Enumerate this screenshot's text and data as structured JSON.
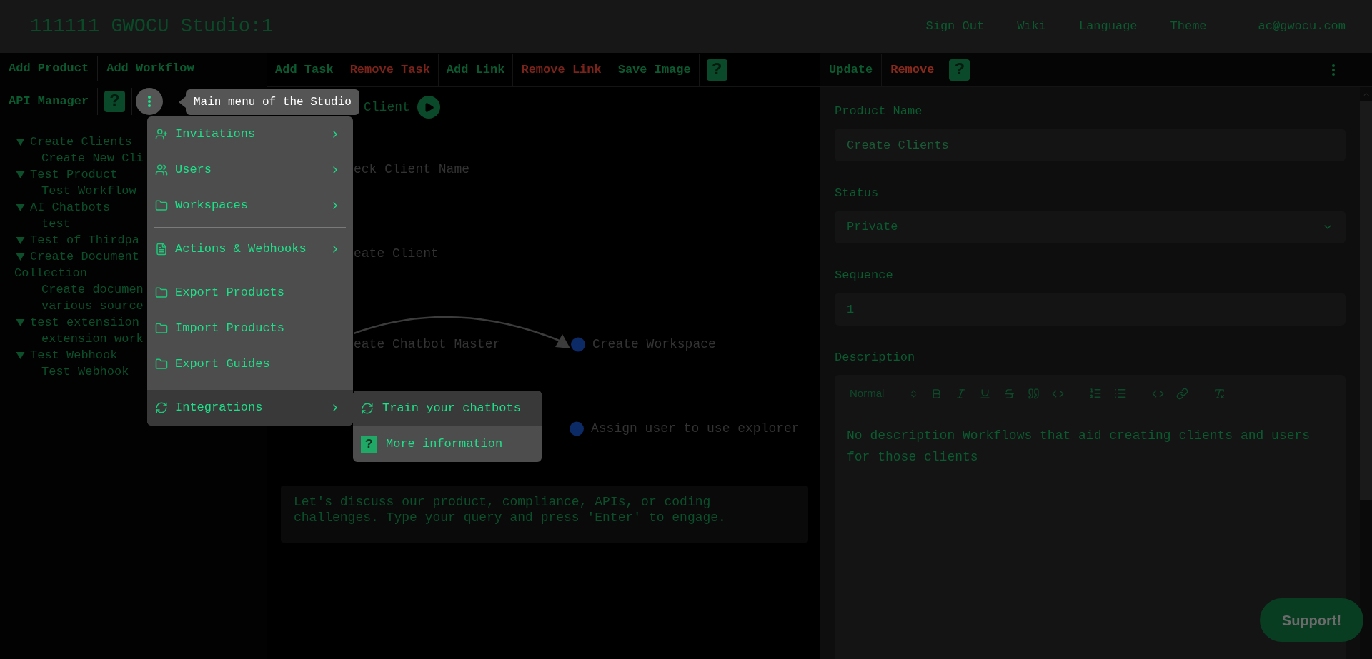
{
  "header": {
    "title": "111111 GWOCU Studio:1",
    "links": [
      "Sign Out",
      "Wiki",
      "Language",
      "Theme",
      "ac@gwocu.com"
    ]
  },
  "left_panel": {
    "toolbar_rows": [
      [
        "Add Product",
        "Add Workflow"
      ],
      [
        "API Manager"
      ]
    ],
    "help": "?",
    "tooltip": "Main menu of the Studio",
    "tree": [
      {
        "label": "Create Clients",
        "expanded": true,
        "children": [
          {
            "label": "Create New Cli"
          }
        ]
      },
      {
        "label": "Test Product",
        "expanded": true,
        "children": [
          {
            "label": "Test Workflow"
          }
        ]
      },
      {
        "label": "AI Chatbots",
        "expanded": true,
        "children": [
          {
            "label": "test"
          }
        ]
      },
      {
        "label": "Test of Thirdpa",
        "expanded": true
      },
      {
        "label": "Create Document\nCollection",
        "expanded": true,
        "children": [
          {
            "label": "Create documen\nvarious source"
          }
        ]
      },
      {
        "label": "test extensiion",
        "expanded": true,
        "children": [
          {
            "label": "extension work"
          }
        ]
      },
      {
        "label": "Test Webhook",
        "expanded": true,
        "children": [
          {
            "label": "Test Webhook"
          }
        ]
      }
    ]
  },
  "main_menu": {
    "items": [
      {
        "kind": "item",
        "label": "Invitations",
        "submenu": true,
        "selected": false
      },
      {
        "kind": "item",
        "label": "Users",
        "submenu": true,
        "selected": false
      },
      {
        "kind": "item",
        "label": "Workspaces",
        "submenu": true,
        "selected": false
      },
      {
        "kind": "separator"
      },
      {
        "kind": "item",
        "label": "Actions & Webhooks",
        "submenu": true,
        "selected": false
      },
      {
        "kind": "separator"
      },
      {
        "kind": "item",
        "label": "Export Products",
        "submenu": false,
        "selected": false
      },
      {
        "kind": "item",
        "label": "Import Products",
        "submenu": false,
        "selected": false
      },
      {
        "kind": "item",
        "label": "Export Guides",
        "submenu": false,
        "selected": false
      },
      {
        "kind": "separator"
      },
      {
        "kind": "item",
        "label": "Integrations",
        "submenu": true,
        "selected": true
      }
    ],
    "submenu": [
      {
        "kind": "action",
        "label": "Train your chatbots",
        "selected": true
      },
      {
        "kind": "help",
        "label": "More information",
        "badge": "?",
        "selected": false
      }
    ]
  },
  "workflow_panel": {
    "toolbar": [
      {
        "label": "Add Task",
        "danger": false
      },
      {
        "label": "Remove Task",
        "danger": true
      },
      {
        "label": "Add Link",
        "danger": false
      },
      {
        "label": "Remove Link",
        "danger": true
      },
      {
        "label": "Save Image",
        "danger": false
      }
    ],
    "help": "?",
    "nodes": [
      {
        "label": "Client",
        "kind": "start"
      },
      {
        "label": "eck Client Name",
        "kind": "plain"
      },
      {
        "label": "eate Client",
        "kind": "plain"
      },
      {
        "label": "eate Chatbot Master",
        "kind": "plain"
      },
      {
        "label": "Create Workspace",
        "kind": "dot"
      },
      {
        "label": "Assign user to use explorer",
        "kind": "dot"
      }
    ],
    "chat": {
      "placeholder": "Let's discuss our product, compliance, APIs, or coding challenges. Type your query and press 'Enter' to engage."
    }
  },
  "product_panel": {
    "toolbar": [
      {
        "label": "Update",
        "danger": false
      },
      {
        "label": "Remove",
        "danger": true
      }
    ],
    "help": "?",
    "fields": [
      {
        "kind": "text",
        "label": "Product Name",
        "placeholder": "Create Clients"
      },
      {
        "kind": "select",
        "label": "Status",
        "value": "Private"
      },
      {
        "kind": "text",
        "label": "Sequence",
        "value": "1"
      }
    ],
    "description": {
      "label": "Description",
      "format": "Normal",
      "text": "No description Workflows that aid creating clients and users for those clients"
    }
  },
  "support_button": "Support!"
}
